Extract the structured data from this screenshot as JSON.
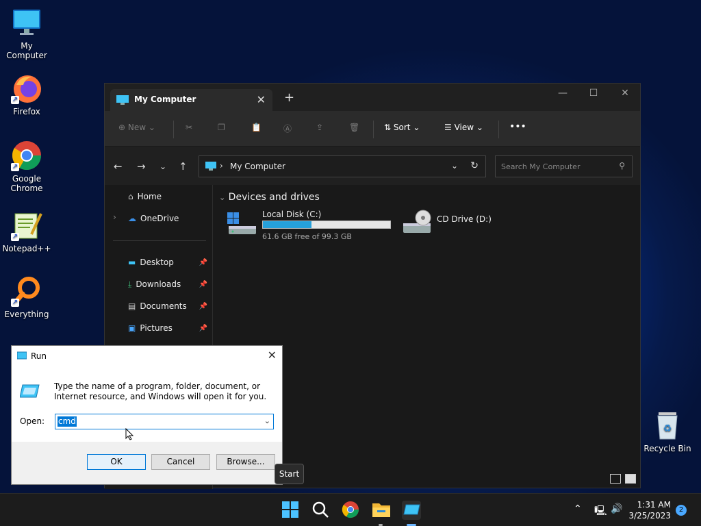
{
  "desktop": {
    "icons": [
      {
        "label": "My Computer"
      },
      {
        "label": "Firefox"
      },
      {
        "label": "Google Chrome"
      },
      {
        "label": "Notepad++"
      },
      {
        "label": "Everything"
      },
      {
        "label": "Recycle Bin"
      }
    ]
  },
  "explorer": {
    "tab_title": "My Computer",
    "toolbar": {
      "new": "New",
      "sort": "Sort",
      "view": "View",
      "more": "•••"
    },
    "address": "My Computer",
    "search_placeholder": "Search My Computer",
    "sidebar": [
      {
        "label": "Home"
      },
      {
        "label": "OneDrive"
      },
      {
        "label": "Desktop"
      },
      {
        "label": "Downloads"
      },
      {
        "label": "Documents"
      },
      {
        "label": "Pictures"
      }
    ],
    "section_title": "Devices and drives",
    "drives": [
      {
        "name": "Local Disk (C:)",
        "usage": "61.6 GB free of 99.3 GB",
        "used_fraction": 0.38
      },
      {
        "name": "CD Drive (D:)"
      }
    ]
  },
  "run": {
    "title": "Run",
    "description": "Type the name of a program, folder, document, or Internet resource, and Windows will open it for you.",
    "open_label": "Open:",
    "value": "cmd",
    "ok": "OK",
    "cancel": "Cancel",
    "browse": "Browse..."
  },
  "tooltip": "Start",
  "taskbar": {
    "time": "1:31 AM",
    "date": "3/25/2023",
    "notifications": "2"
  }
}
